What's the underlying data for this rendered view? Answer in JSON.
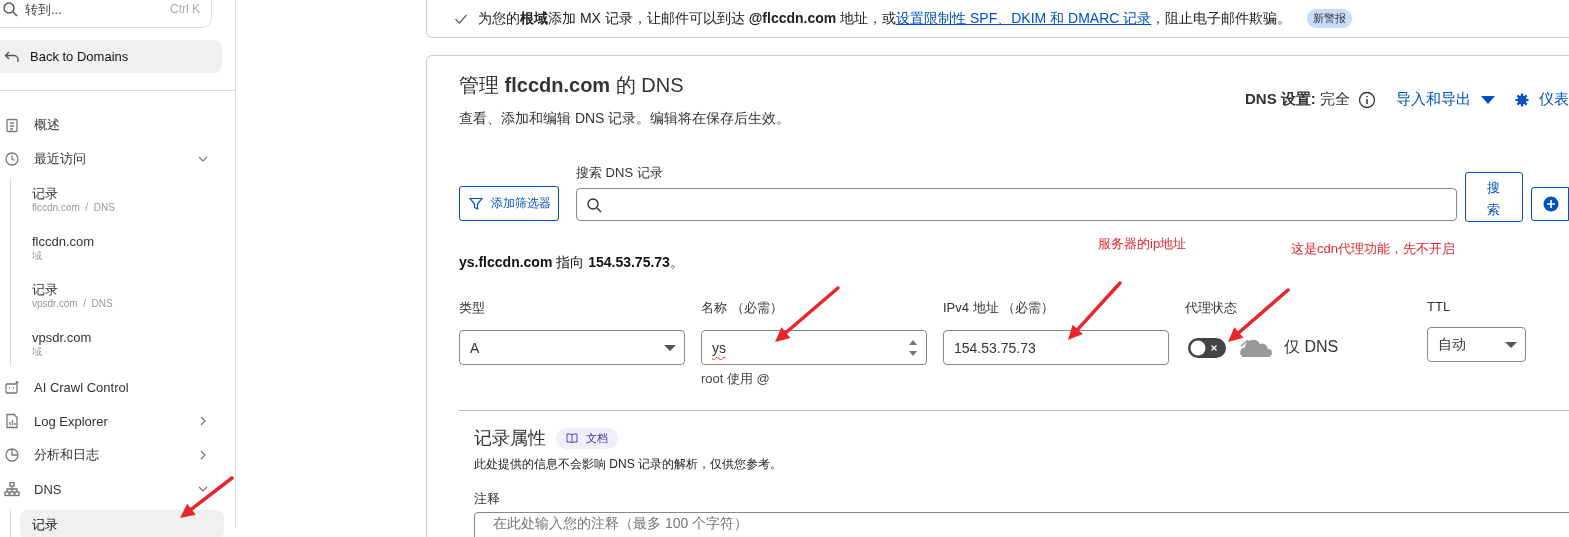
{
  "sidebar": {
    "search": {
      "placeholder": "转到...",
      "shortcut": "Ctrl K"
    },
    "back_button": "Back to Domains",
    "items": [
      {
        "label": "概述"
      },
      {
        "label": "最近访问",
        "expanded": true,
        "children": [
          {
            "label": "记录",
            "sublabel": "flccdn.com  /  DNS",
            "selected": false
          },
          {
            "label": "flccdn.com",
            "sublabel": "域",
            "selected": false
          },
          {
            "label": "记录",
            "sublabel": "vpsdr.com  /  DNS",
            "selected": false
          },
          {
            "label": "vpsdr.com",
            "sublabel": "域",
            "selected": false
          }
        ]
      },
      {
        "label": "AI Crawl Control"
      },
      {
        "label": "Log Explorer",
        "expanded": false
      },
      {
        "label": "分析和日志",
        "expanded": false
      },
      {
        "label": "DNS",
        "expanded": true,
        "children": [
          {
            "label": "记录",
            "selected": true
          }
        ]
      }
    ]
  },
  "alert": {
    "text": "为您的**根域**添加 MX 记录，让邮件可以到达 **@flccdn.com** 地址，或",
    "link": "设置限制性 SPF、DKIM 和 DMARC 记录",
    "text_after": "，阻止电子邮件欺骗。",
    "badge": "新警报"
  },
  "dns_card": {
    "title": "管理 **flccdn.com** 的 DNS",
    "subtitle": "查看、添加和编辑 DNS 记录。编辑将在保存后生效。",
    "settings": "**DNS 设置:** 完全",
    "import_export": "导入和导出",
    "dashboard": "仪表",
    "search": {
      "label": "搜索 DNS 记录",
      "filter_button": "添加筛选器",
      "search_button": "搜索"
    },
    "summary": "**ys.flccdn.com** 指向 **154.53.75.73**。",
    "fields": [
      {
        "kind": "select",
        "label": "类型",
        "value": "A"
      },
      {
        "kind": "spin",
        "label": "名称 （必需）",
        "value": "ys",
        "hint": "root 使用 @"
      },
      {
        "kind": "text",
        "label": "IPv4 地址 （必需）",
        "value": "154.53.75.73"
      },
      {
        "kind": "toggle",
        "label": "代理状态",
        "on": false,
        "value": "仅 DNS"
      },
      {
        "kind": "select",
        "label": "TTL",
        "value": "自动"
      }
    ],
    "attributes": {
      "title": "记录属性",
      "doc_badge": "文档",
      "description": "此处提供的信息不会影响 DNS 记录的解析，仅供您参考。",
      "comment": {
        "label": "注释",
        "placeholder": "在此处输入您的注释（最多 100 个字符）"
      }
    }
  },
  "annotations": [
    {
      "text": "服务器的ip地址",
      "color": "#e8262c"
    },
    {
      "text": "这是cdn代理功能，先不开启",
      "color": "#e8262c"
    }
  ]
}
